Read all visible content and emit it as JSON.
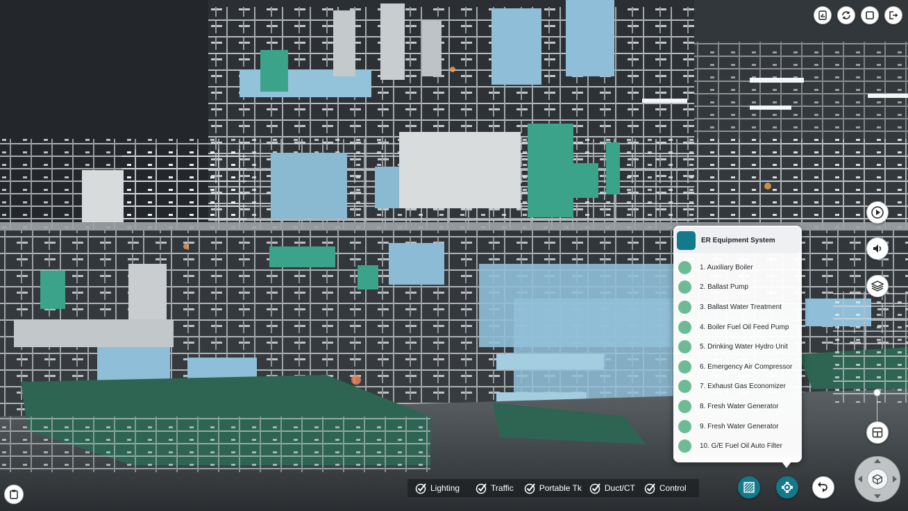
{
  "toolbar": {
    "icons": [
      "report-icon",
      "refresh-icon",
      "fullscreen-icon",
      "exit-icon"
    ]
  },
  "side_controls": {
    "icons": [
      "play-icon",
      "volume-icon",
      "layers-icon",
      "layout-grid-icon"
    ]
  },
  "equipment_panel": {
    "title": "ER Equipment System",
    "accent": "#137a8c",
    "dot_color": "#6dbb94",
    "items": [
      "1. Auxiliary Boiler",
      "2. Ballast Pump",
      "3. Ballast Water Treatment",
      "4. Boiler Fuel Oil Feed Pump",
      "5. Drinking Water Hydro Unit",
      "6. Emergency Air Compressor",
      "7. Exhaust Gas Economizer",
      "8. Fresh Water Generator",
      "9. Fresh Water Generator",
      "10. G/E Fuel Oil Auto Filter"
    ]
  },
  "toggles": [
    {
      "label": "Lighting",
      "checked": true
    },
    {
      "label": "Traffic",
      "checked": true
    },
    {
      "label": "Portable Tk",
      "checked": true
    },
    {
      "label": "Duct/CT",
      "checked": true
    },
    {
      "label": "Control",
      "checked": true
    }
  ],
  "bottom_controls": {
    "pattern_color": "#137a8c",
    "equipment_color": "#137a8c"
  },
  "navigation": {
    "center_icon": "cube-icon"
  }
}
